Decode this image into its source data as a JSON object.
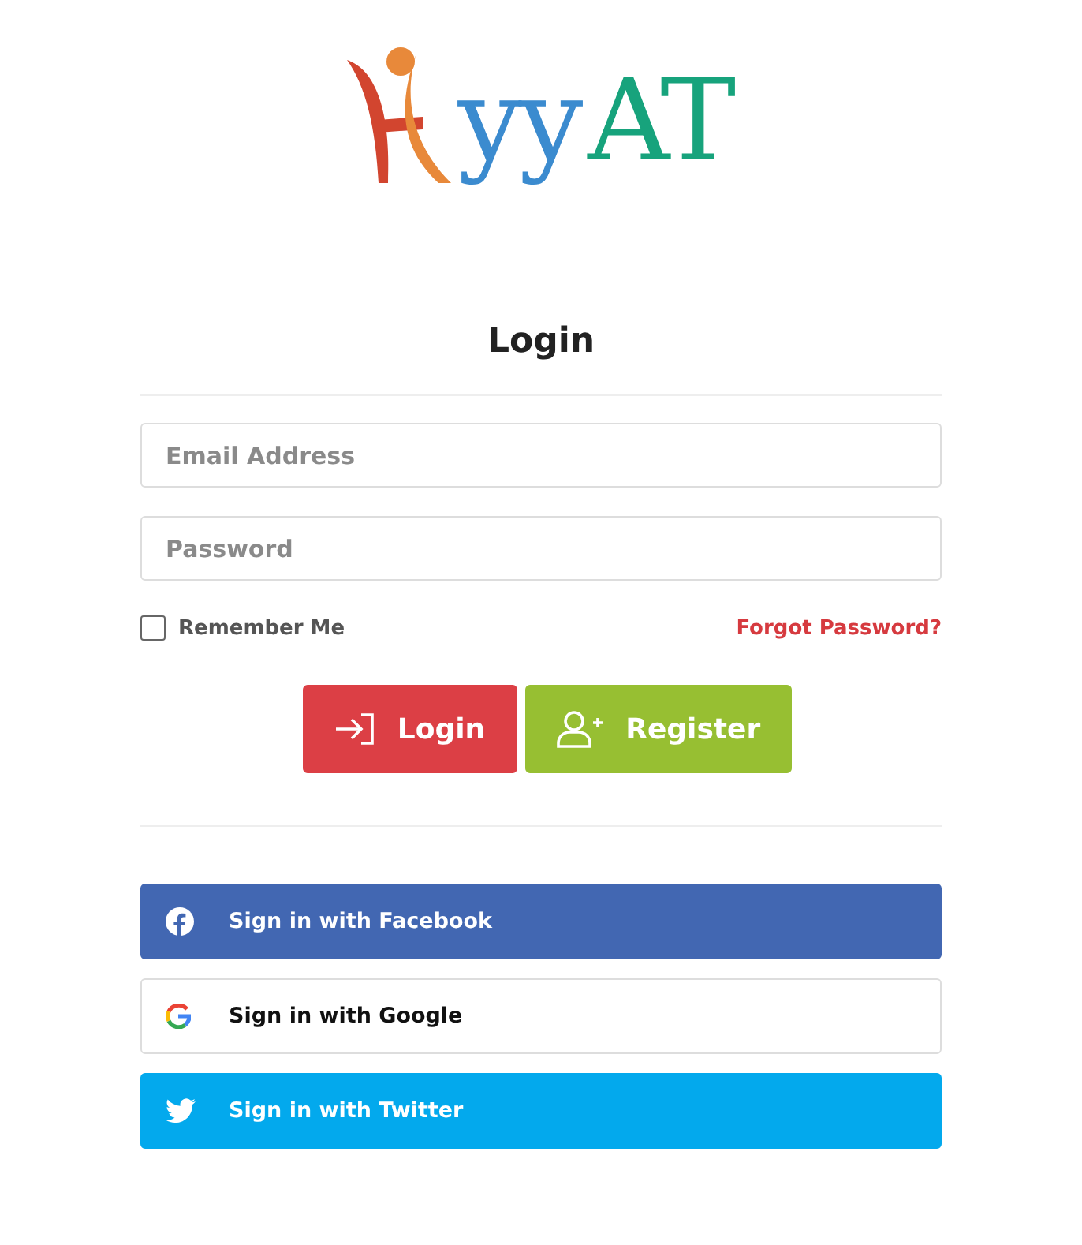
{
  "logo": {
    "parts": [
      {
        "text": "yy",
        "color": "#3b8bcf"
      },
      {
        "text": "AT",
        "color": "#17a37c"
      }
    ]
  },
  "title": "Login",
  "fields": [
    {
      "placeholder": "Email Address"
    },
    {
      "placeholder": "Password"
    }
  ],
  "remember": {
    "label": "Remember Me",
    "checked": false
  },
  "forgot_link": "Forgot Password?",
  "buttons": [
    {
      "kind": "login",
      "label": "Login"
    },
    {
      "kind": "register",
      "label": "Register"
    }
  ],
  "social": [
    {
      "kind": "facebook",
      "label": "Sign in with Facebook"
    },
    {
      "kind": "google",
      "label": "Sign in with Google"
    },
    {
      "kind": "twitter",
      "label": "Sign in with Twitter"
    }
  ]
}
